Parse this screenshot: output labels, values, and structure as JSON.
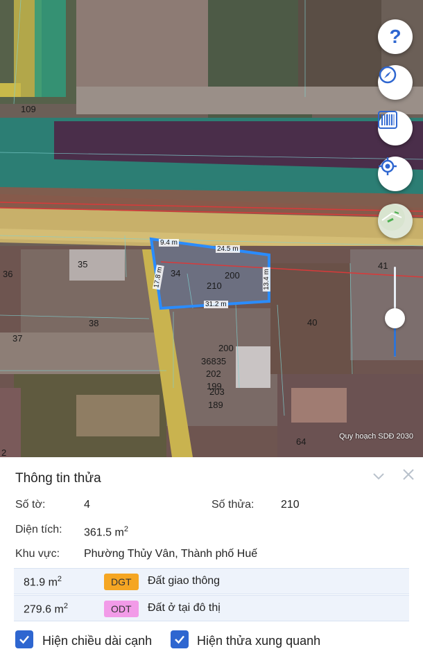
{
  "map": {
    "plot_labels": [
      "109",
      "35",
      "36",
      "34",
      "200",
      "210",
      "41",
      "38",
      "37",
      "40",
      "200",
      "36835",
      "202",
      "199",
      "203",
      "189",
      "64",
      "2"
    ],
    "edge_labels": [
      "9.4 m",
      "24.5 m",
      "17.8 m",
      "13.4 m",
      "31.2 m"
    ],
    "caption": "Quy hoạch SDĐ 2030",
    "buttons": {
      "help_icon": "question-icon",
      "compass_icon": "compass-icon",
      "barcode_icon": "barcode-icon",
      "locate_icon": "locate-icon",
      "layer_icon": "map-layer-icon"
    },
    "zoom_slider_level": 0.42
  },
  "panel": {
    "title": "Thông tin thửa",
    "sheet_label": "Số tờ:",
    "sheet_value": "4",
    "parcel_label": "Số thửa:",
    "parcel_value": "210",
    "area_label": "Diện tích:",
    "area_value": "361.5 m",
    "area_unit_sup": "2",
    "region_label": "Khu vực:",
    "region_value": "Phường Thủy Vân, Thành phố Huế",
    "land_uses": [
      {
        "area": "81.9 m",
        "sup": "2",
        "code": "DGT",
        "code_color": "#f5a623",
        "desc": "Đất giao thông"
      },
      {
        "area": "279.6 m",
        "sup": "2",
        "code": "ODT",
        "code_color": "#f29be8",
        "desc": "Đất ở tại đô thị"
      }
    ],
    "checkbox_edges": "Hiện chiều dài cạnh",
    "checkbox_neighbors": "Hiện thửa xung quanh"
  },
  "colors": {
    "accent": "#2e66d0",
    "parcel_outline": "#2a8cff"
  }
}
